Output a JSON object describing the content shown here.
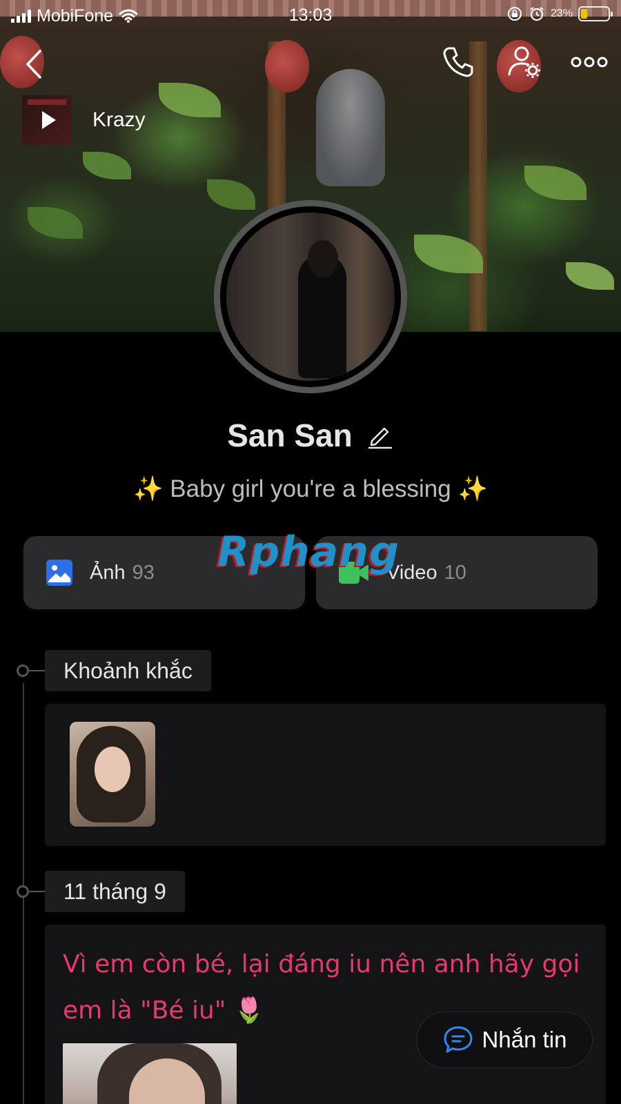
{
  "status_bar": {
    "carrier": "MobiFone",
    "time": "13:03",
    "battery_percent": "23%",
    "battery_level": 0.23
  },
  "music": {
    "title": "Krazy"
  },
  "profile": {
    "name": "San San",
    "bio_text": " Baby girl you're a blessing ",
    "bio_sparkle": "✨"
  },
  "media": {
    "photos_label": "Ảnh",
    "photos_count": "93",
    "videos_label": "Video",
    "videos_count": "10"
  },
  "watermark": {
    "text": "Rphang"
  },
  "timeline": {
    "moments_label": "Khoảnh khắc",
    "date_label": "11 tháng 9",
    "post_text": "Vì em còn bé, lại đáng iu nên anh hãy gọi em là \"Bé iu\" 🌷"
  },
  "actions": {
    "message_label": "Nhắn tin"
  },
  "colors": {
    "accent_blue": "#2d6fe8",
    "video_green": "#3ec15b",
    "post_text_pink": "#e8396c",
    "sparkle_gold": "#f3c54b"
  },
  "icons": {
    "back": "chevron-left-icon",
    "call": "phone-icon",
    "profile_settings": "user-gear-icon",
    "more": "more-dots-icon",
    "play": "play-icon",
    "edit": "pencil-icon",
    "photos": "image-icon",
    "videos": "video-camera-icon",
    "message": "chat-bubble-icon"
  }
}
